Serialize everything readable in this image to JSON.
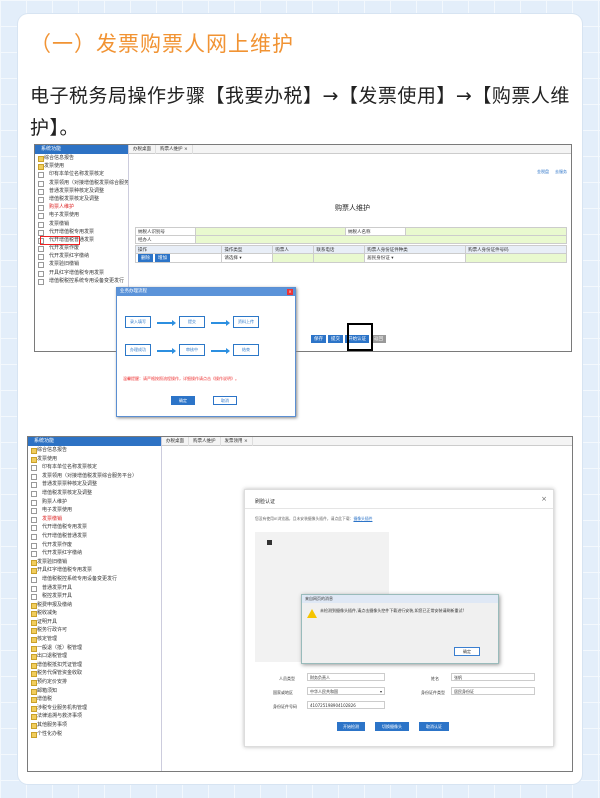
{
  "title": "（一）发票购票人网上维护",
  "intro": "电子税务局操作步骤【我要办税】→【发票使用】→【购票人维护】。",
  "shot1": {
    "sidebar_header": "系统功能",
    "tabs": [
      "办税桌面",
      "购票人维护"
    ],
    "tab_close": "×",
    "sidebar_items": [
      "综合信息报告",
      "发票使用",
      "印有本单位名称发票核定",
      "发票领用（对接增值税发票综合服务平台）",
      "普通发票票种核定及调整",
      "增值税发票核定及调整",
      "购票人维护",
      "电子发票使用",
      "发票缴销",
      "代开增值税专用发票",
      "代开增值税普通发票",
      "代开发票作废",
      "代开发票红字缴纳",
      "发票验旧缴销",
      "开具红字增值税专用发票",
      "增值税税控系统专用设备变更发行"
    ],
    "right_links": [
      "金税盘",
      "去服务"
    ],
    "form_title": "购票人维护",
    "row1": [
      "纳税人识别号",
      "纳税人名称"
    ],
    "row2": [
      "经办人"
    ],
    "head": [
      "操作",
      "操作类型",
      "购票人",
      "联系电话",
      "购票人身份证件种类",
      "购票人身份证件号码"
    ],
    "row3": [
      "删除",
      "增加",
      "请选择",
      "居民身份证"
    ],
    "bottom_btns": [
      "保存",
      "提交",
      "开始认证",
      "返回"
    ],
    "dialog": {
      "bar": "业务办理流程",
      "steps": [
        "录入填写",
        "提交",
        "资料上传",
        "办理成功",
        "审核中",
        "结束"
      ],
      "note": "温馨提醒：请严格按照流程操作，详细操作请点击《操作说明》。",
      "ok": "确定",
      "cancel": "取消"
    }
  },
  "shot2": {
    "sidebar_header": "系统功能",
    "tabs": [
      "办税桌面",
      "购票人维护",
      "发票领用"
    ],
    "tab_close": "×",
    "sidebar_items": [
      "综合信息报告",
      "发票使用",
      "印有本单位名称发票核定",
      "发票领用（对接增值税发票综合服务平台）",
      "普通发票票种核定及调整",
      "增值税发票核定及调整",
      "购票人维护",
      "电子发票使用",
      "发票缴销",
      "代开增值税专用发票",
      "代开增值税普通发票",
      "代开发票作废",
      "代开发票红字缴纳",
      "发票验旧缴销",
      "开具红字增值税专用发票",
      "增值税税控系统专用设备变更发行",
      "普通发票开具",
      "税控发票开具",
      "税费申报及缴纳",
      "税收减免",
      "证明开具",
      "税务行政许可",
      "核定管理",
      "一般退（抵）税管理",
      "出口退税管理",
      "增值税抵扣凭证管理",
      "税务代保管资金收取",
      "预约定价安排",
      "邮箱须知",
      "增值税",
      "涉税专业服务机构管理",
      "法律追溯与救济事项",
      "其他服务事项",
      "个性化办税"
    ],
    "modal": {
      "title": "刷脸认证",
      "close": "×",
      "hint_prefix": "您没有使用IE浏览器，且未安装摄像头插件，请点此下载：",
      "hint_link": "摄像头插件",
      "alert_title": "来自网页的消息",
      "alert_text": "未检测到摄像头插件,请点击摄像头控件下载进行安装,如您已正常安装请刷新重试!",
      "alert_ok": "确定",
      "fields": [
        {
          "label": "人员类型",
          "value": "财务负责人"
        },
        {
          "label": "姓名",
          "value": "张帆"
        },
        {
          "label": "国家或地区",
          "value": "中华人民共和国"
        },
        {
          "label": "身份证件类型",
          "value": "居民身份证"
        },
        {
          "label": "身份证件号码",
          "value": "41072519890410282​6"
        }
      ],
      "buttons": [
        "开始检测",
        "切换摄像头",
        "取消认证"
      ]
    }
  }
}
